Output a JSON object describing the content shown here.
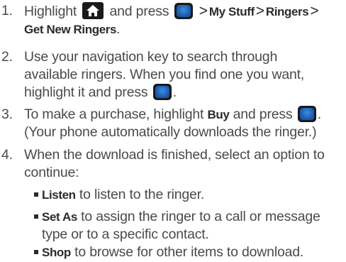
{
  "steps": [
    {
      "num": "1.",
      "pre": "Highlight",
      "mid": "and press",
      "path": [
        "My Stuff",
        "Ringers",
        "Get New Ringers"
      ],
      "end": "."
    },
    {
      "num": "2.",
      "line1": "Use your navigation key to search through",
      "line2": "available ringers. When you find one you want,",
      "line3_pre": "highlight it and press",
      "end": "."
    },
    {
      "num": "3.",
      "pre": "To make a purchase, highlight",
      "buy": "Buy",
      "mid": "and press",
      "end": ".",
      "line2": "(Your phone automatically downloads the ringer.)"
    },
    {
      "num": "4.",
      "line1": "When the download is finished, select an option to",
      "line2": "continue:"
    }
  ],
  "options": [
    {
      "label": "Listen",
      "text": "to listen to the ringer."
    },
    {
      "label": "Set As",
      "text": "to assign the ringer to a call or message",
      "text2": "type or to a specific contact."
    },
    {
      "label": "Shop",
      "text": "to browse for other items to download."
    }
  ],
  "separator": ">",
  "icons": {
    "home_key": "home-key-icon",
    "menu_ok_key": "menu-ok-key-icon"
  }
}
